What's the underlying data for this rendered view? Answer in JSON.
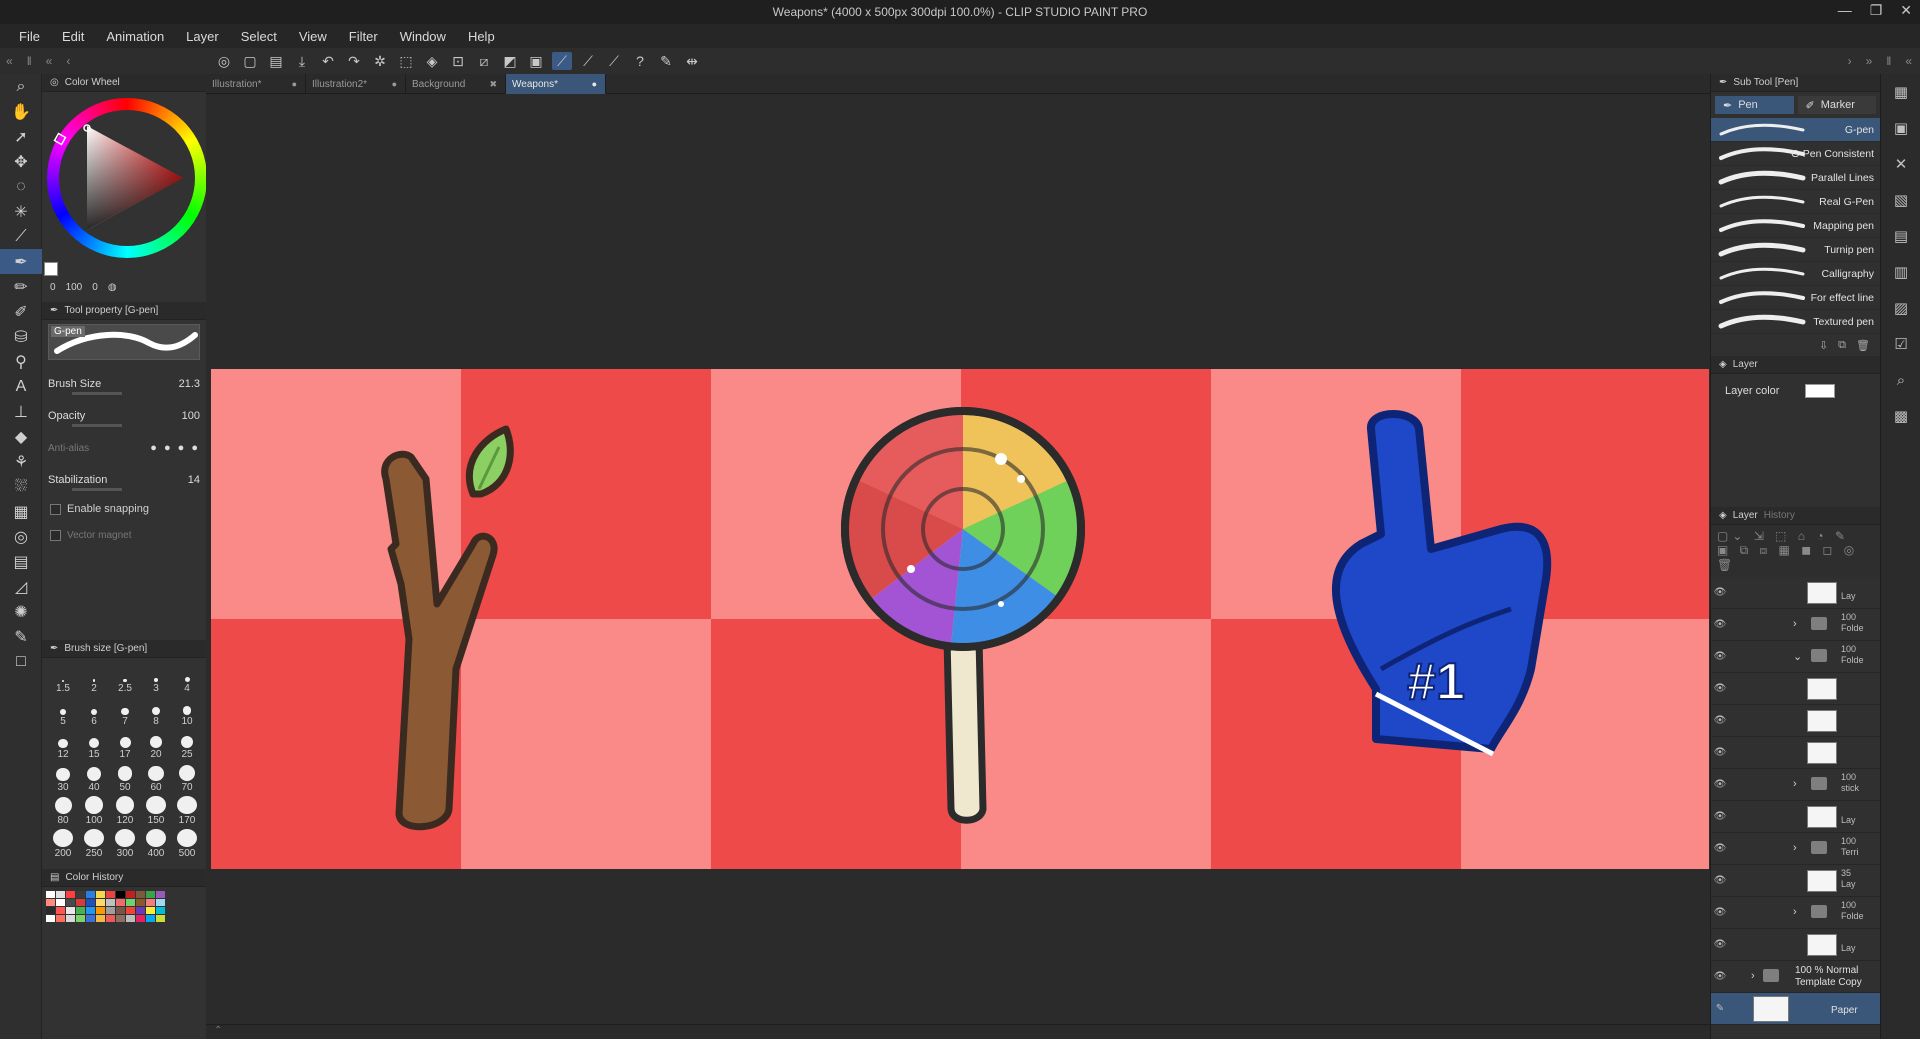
{
  "window": {
    "title": "Weapons* (4000 x 500px 300dpi 100.0%) - CLIP STUDIO PAINT PRO",
    "controls": [
      "—",
      "❐",
      "✕"
    ]
  },
  "menu": [
    "File",
    "Edit",
    "Animation",
    "Layer",
    "Select",
    "View",
    "Filter",
    "Window",
    "Help"
  ],
  "tabs": [
    {
      "label": "Illustration*",
      "close": "●"
    },
    {
      "label": "Illustration2*",
      "close": "●"
    },
    {
      "label": "Background",
      "close": "✖"
    },
    {
      "label": "Weapons*",
      "close": "●"
    }
  ],
  "color_wheel": {
    "title": "Color Wheel",
    "values": [
      "0",
      "100",
      "0"
    ]
  },
  "tool_property": {
    "title": "Tool property [G-pen]",
    "brush_tag": "G-pen",
    "brush_size_label": "Brush Size",
    "brush_size_value": "21.3",
    "opacity_label": "Opacity",
    "opacity_value": "100",
    "antialias_label": "Anti-alias",
    "stabilization_label": "Stabilization",
    "stabilization_value": "14",
    "snapping_label": "Enable snapping",
    "vector_magnet_label": "Vector magnet"
  },
  "brush_size_panel": {
    "title": "Brush size [G-pen]",
    "sizes": [
      "1.5",
      "2",
      "2.5",
      "3",
      "4",
      "5",
      "6",
      "7",
      "8",
      "10",
      "12",
      "15",
      "17",
      "20",
      "25",
      "30",
      "40",
      "50",
      "60",
      "70",
      "80",
      "100",
      "120",
      "150",
      "170",
      "200",
      "250",
      "300",
      "400",
      "500"
    ]
  },
  "color_history": {
    "title": "Color History",
    "colors": [
      "#ffffff",
      "#e0e0e0",
      "#ff4040",
      "#3a3a3a",
      "#2a7de1",
      "#f6d64a",
      "#e94242",
      "#000000",
      "#c02020",
      "#7d5a3c",
      "#3aa34a",
      "#9b59b6",
      "#ff8a80",
      "#ffffff",
      "#4a4a4a",
      "#d63b3b",
      "#1e4fbf",
      "#ffd966",
      "#c0c0c0",
      "#ef6c6c",
      "#6fd16f",
      "#8b5a2b",
      "#f08080",
      "#a0d8ef",
      "#2b2b2b",
      "#ff5555",
      "#e8e8e8",
      "#4caf50",
      "#2196f3",
      "#ff9800",
      "#9e9e9e",
      "#795548",
      "#f44336",
      "#673ab7",
      "#ffeb3b",
      "#00bcd4",
      "#ffffff",
      "#ff6f61",
      "#d9d9d9",
      "#7bd36b",
      "#3b6fd9",
      "#f4b942",
      "#ee5a5a",
      "#8d6e63",
      "#bdbdbd",
      "#e91e63",
      "#03a9f4",
      "#cddc39"
    ]
  },
  "sub_tool": {
    "title": "Sub Tool [Pen]",
    "groups": [
      "Pen",
      "Marker"
    ],
    "brushes": [
      "G-pen",
      "G-Pen Consistent",
      "Parallel Lines",
      "Real G-Pen",
      "Mapping pen",
      "Turnip pen",
      "Calligraphy",
      "For effect line",
      "Textured pen"
    ]
  },
  "layer_property": {
    "tab": "Layer",
    "layer_color_label": "Layer color"
  },
  "layer_panel": {
    "tabs": [
      "Layer",
      "History"
    ],
    "rows": [
      {
        "type": "layer",
        "meta1": "",
        "meta2": "Lay"
      },
      {
        "type": "folder",
        "meta1": "100",
        "meta2": "Folde"
      },
      {
        "type": "folder-open",
        "meta1": "100",
        "meta2": "Folde"
      },
      {
        "type": "layer",
        "meta1": "",
        "meta2": ""
      },
      {
        "type": "layer",
        "meta1": "",
        "meta2": ""
      },
      {
        "type": "layer",
        "meta1": "",
        "meta2": ""
      },
      {
        "type": "folder",
        "meta1": "100",
        "meta2": "stick"
      },
      {
        "type": "layer",
        "meta1": "",
        "meta2": "Lay"
      },
      {
        "type": "folder",
        "meta1": "100",
        "meta2": "Terri"
      },
      {
        "type": "layer",
        "meta1": "35",
        "meta2": "Lay"
      },
      {
        "type": "folder",
        "meta1": "100",
        "meta2": "Folde"
      },
      {
        "type": "layer",
        "meta1": "",
        "meta2": "Lay"
      }
    ],
    "template_meta1": "100 % Normal",
    "template_meta2": "Template Copy",
    "paper_label": "Paper"
  },
  "colors": {
    "accent": "#3a5679",
    "board_light": "#fa8a87",
    "board_dark": "#ef4a4a",
    "foam_blue": "#1f48c8"
  },
  "artwork": {
    "foam_finger_text": "#1"
  }
}
